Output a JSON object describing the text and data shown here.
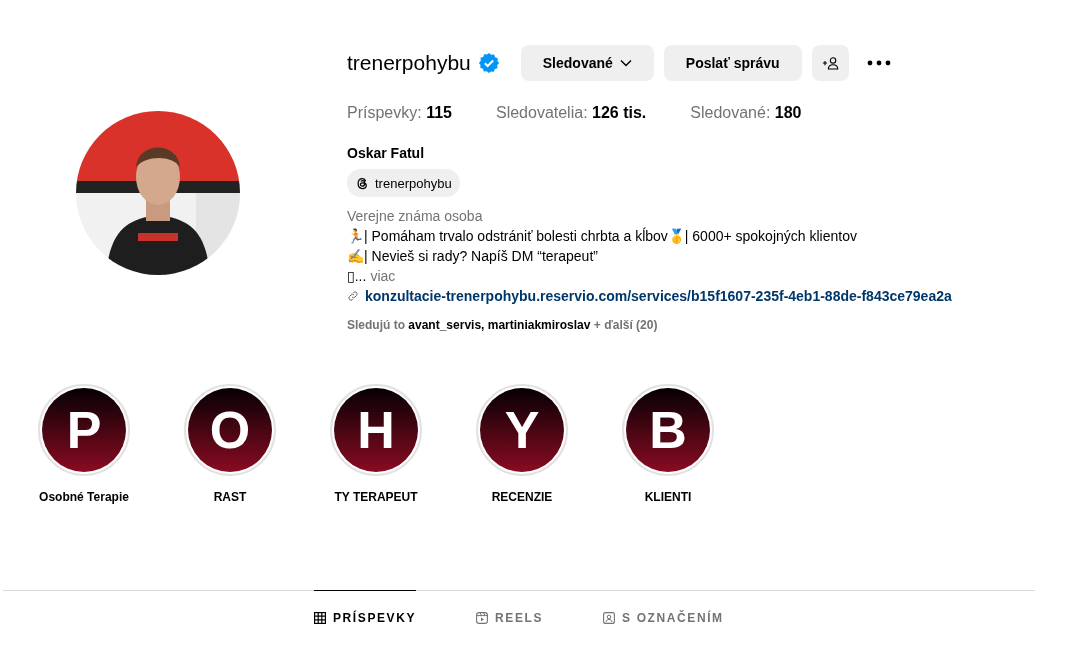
{
  "profile": {
    "username": "trenerpohybu",
    "verified": true,
    "buttons": [
      {
        "kind": "dropdown",
        "label": "Sledované"
      },
      {
        "kind": "plain",
        "label": "Poslať správu"
      },
      {
        "kind": "add-person"
      },
      {
        "kind": "more"
      }
    ],
    "stats": [
      {
        "label": "Príspevky:",
        "value": "115"
      },
      {
        "label": "Sledovatelia:",
        "value": "126 tis."
      },
      {
        "label": "Sledované:",
        "value": "180"
      }
    ],
    "name": "Oskar Fatul",
    "threads_badge": "trenerpohybu",
    "category": "Verejne známa osoba",
    "bio_lines": [
      "🏃| Pomáham trvalo odstrániť bolesti chrbta a kĺbov🥇| 6000+ spokojných klientov",
      "✍️| Nevieš si rady? Napíš DM “terapeut”"
    ],
    "bio_truncated": "▯...",
    "more_link": "viac",
    "link": "konzultacie-trenerpohybu.reservio.com/services/b15f1607-235f-4eb1-88de-f843ce79ea2a",
    "followed_by": {
      "prefix": "Sledujú to",
      "names": "avant_servis, martiniakmiroslav",
      "more": "+ ďalší (20)"
    }
  },
  "highlights": [
    {
      "letter": "P",
      "label": "Osobné Terapie"
    },
    {
      "letter": "O",
      "label": "RAST"
    },
    {
      "letter": "H",
      "label": "TY TERAPEUT"
    },
    {
      "letter": "Y",
      "label": "RECENZIE"
    },
    {
      "letter": "B",
      "label": "KLIENTI"
    }
  ],
  "tabs": [
    {
      "kind": "grid",
      "label": "PRÍSPEVKY",
      "selected": true
    },
    {
      "kind": "reels",
      "label": "REELS",
      "selected": false
    },
    {
      "kind": "tagged",
      "label": "S OZNAČENÍM",
      "selected": false
    }
  ]
}
